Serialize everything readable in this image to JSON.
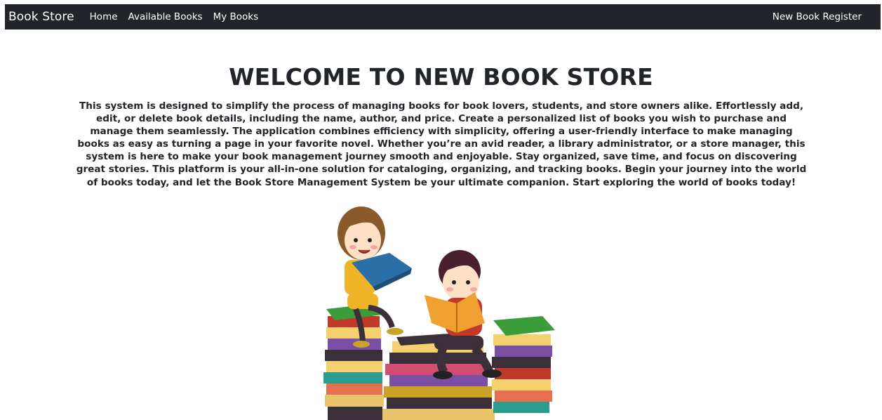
{
  "navbar": {
    "brand": "Book Store",
    "links": [
      "Home",
      "Available Books",
      "My Books"
    ],
    "right_link": "New Book Register",
    "bg_color": "#212529"
  },
  "hero": {
    "title": "WELCOME TO NEW BOOK STORE",
    "description": "This system is designed to simplify the process of managing books for book lovers, students, and store owners alike. Effortlessly add, edit, or delete book details, including the name, author, and price. Create a personalized list of books you wish to purchase and manage them seamlessly. The application combines efficiency with simplicity, offering a user-friendly interface to make managing books as easy as turning a page in your favorite novel. Whether you’re an avid reader, a library administrator, or a store manager, this system is here to make your book management journey smooth and enjoyable. Stay organized, save time, and focus on discovering great stories. This platform is your all-in-one solution for cataloging, organizing, and tracking books. Begin your journey into the world of books today, and let the Book Store Management System be your ultimate companion. Start exploring the world of books today!"
  },
  "illustration": {
    "icon": "kids-reading-books-illustration"
  }
}
